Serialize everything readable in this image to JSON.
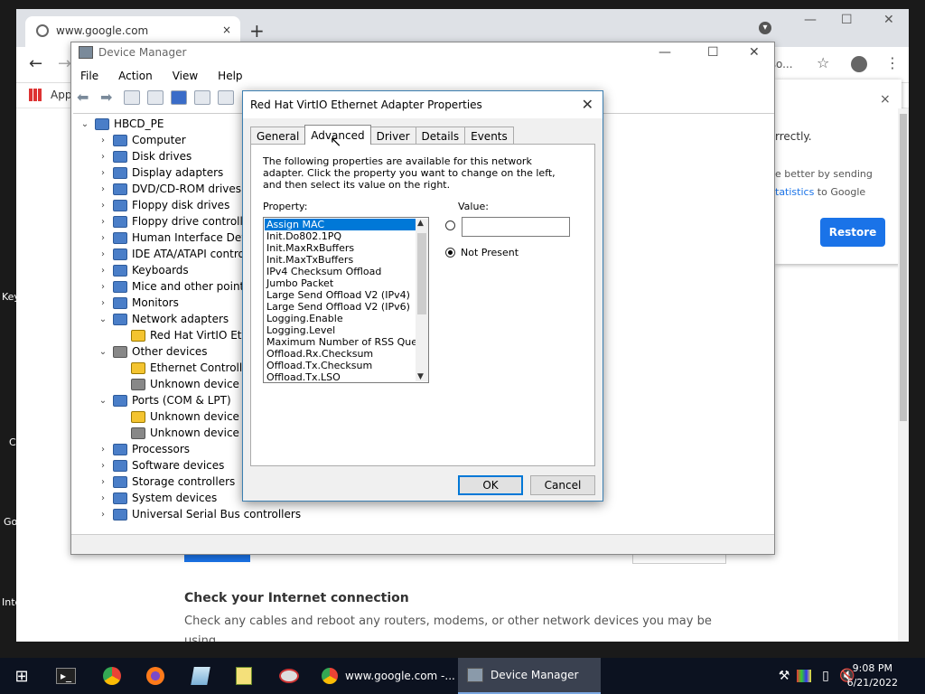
{
  "desktop_labels": [
    "Key",
    "C",
    "Go",
    "Inte"
  ],
  "chrome": {
    "tab_title": "www.google.com",
    "tab_close": "×",
    "new_tab": "+",
    "menu_caret": "▾",
    "omnibox_tail": "tso...",
    "bookmarks_apps": "Apps",
    "page": {
      "heading": "Check your Internet connection",
      "body": "Check any cables and reboot any routers, modems, or other network devices you may be",
      "body_tail": "using."
    },
    "restore_panel": {
      "line1": "rrectly.",
      "line2": "e better by sending",
      "line3_link": "tatistics",
      "line3_rest": " to Google",
      "restore_button": "Restore",
      "close": "×"
    }
  },
  "device_manager": {
    "title": "Device Manager",
    "menu": [
      "File",
      "Action",
      "View",
      "Help"
    ],
    "tree": [
      {
        "label": "HBCD_PE",
        "level": 0,
        "exp": "open",
        "icon": "computer"
      },
      {
        "label": "Computer",
        "level": 1,
        "exp": "closed",
        "icon": "computer"
      },
      {
        "label": "Disk drives",
        "level": 1,
        "exp": "closed",
        "icon": "disk"
      },
      {
        "label": "Display adapters",
        "level": 1,
        "exp": "closed",
        "icon": "display"
      },
      {
        "label": "DVD/CD-ROM drives",
        "level": 1,
        "exp": "closed",
        "icon": "dvd"
      },
      {
        "label": "Floppy disk drives",
        "level": 1,
        "exp": "closed",
        "icon": "floppy"
      },
      {
        "label": "Floppy drive controllers",
        "level": 1,
        "exp": "closed",
        "icon": "controller"
      },
      {
        "label": "Human Interface Devices",
        "level": 1,
        "exp": "closed",
        "icon": "hid"
      },
      {
        "label": "IDE ATA/ATAPI controllers",
        "level": 1,
        "exp": "closed",
        "icon": "ide"
      },
      {
        "label": "Keyboards",
        "level": 1,
        "exp": "closed",
        "icon": "keyboard"
      },
      {
        "label": "Mice and other pointing devices",
        "level": 1,
        "exp": "closed",
        "icon": "mouse"
      },
      {
        "label": "Monitors",
        "level": 1,
        "exp": "closed",
        "icon": "monitor"
      },
      {
        "label": "Network adapters",
        "level": 1,
        "exp": "open",
        "icon": "network"
      },
      {
        "label": "Red Hat VirtIO Ethernet Adapter",
        "level": 2,
        "exp": "none",
        "icon": "warn"
      },
      {
        "label": "Other devices",
        "level": 1,
        "exp": "open",
        "icon": "unknown"
      },
      {
        "label": "Ethernet Controller",
        "level": 2,
        "exp": "none",
        "icon": "warn"
      },
      {
        "label": "Unknown device",
        "level": 2,
        "exp": "none",
        "icon": "unknown"
      },
      {
        "label": "Ports (COM & LPT)",
        "level": 1,
        "exp": "open",
        "icon": "port"
      },
      {
        "label": "Unknown device",
        "level": 2,
        "exp": "none",
        "icon": "warn"
      },
      {
        "label": "Unknown device",
        "level": 2,
        "exp": "none",
        "icon": "gray"
      },
      {
        "label": "Processors",
        "level": 1,
        "exp": "closed",
        "icon": "processor"
      },
      {
        "label": "Software devices",
        "level": 1,
        "exp": "closed",
        "icon": "software"
      },
      {
        "label": "Storage controllers",
        "level": 1,
        "exp": "closed",
        "icon": "storage"
      },
      {
        "label": "System devices",
        "level": 1,
        "exp": "closed",
        "icon": "system"
      },
      {
        "label": "Universal Serial Bus controllers",
        "level": 1,
        "exp": "closed",
        "icon": "usb"
      }
    ]
  },
  "props": {
    "title": "Red Hat VirtIO Ethernet Adapter Properties",
    "tabs": [
      "General",
      "Advanced",
      "Driver",
      "Details",
      "Events"
    ],
    "active_tab": "Advanced",
    "description": "The following properties are available for this network adapter. Click the property you want to change on the left, and then select its value on the right.",
    "property_label": "Property:",
    "value_label": "Value:",
    "properties": [
      "Assign MAC",
      "Init.Do802.1PQ",
      "Init.MaxRxBuffers",
      "Init.MaxTxBuffers",
      "IPv4 Checksum Offload",
      "Jumbo Packet",
      "Large Send Offload V2 (IPv4)",
      "Large Send Offload V2 (IPv6)",
      "Logging.Enable",
      "Logging.Level",
      "Maximum Number of RSS Queues",
      "Offload.Rx.Checksum",
      "Offload.Tx.Checksum",
      "Offload.Tx.LSO"
    ],
    "selected_property": "Assign MAC",
    "value_text": "",
    "not_present_label": "Not Present",
    "not_present_checked": true,
    "ok": "OK",
    "cancel": "Cancel"
  },
  "taskbar": {
    "apps": [
      {
        "label": "www.google.com -...",
        "icon": "chrome-icon",
        "active": false
      },
      {
        "label": "Device Manager",
        "icon": "device-manager-icon",
        "active": true
      }
    ],
    "time": "9:08 PM",
    "date": "6/21/2022"
  }
}
